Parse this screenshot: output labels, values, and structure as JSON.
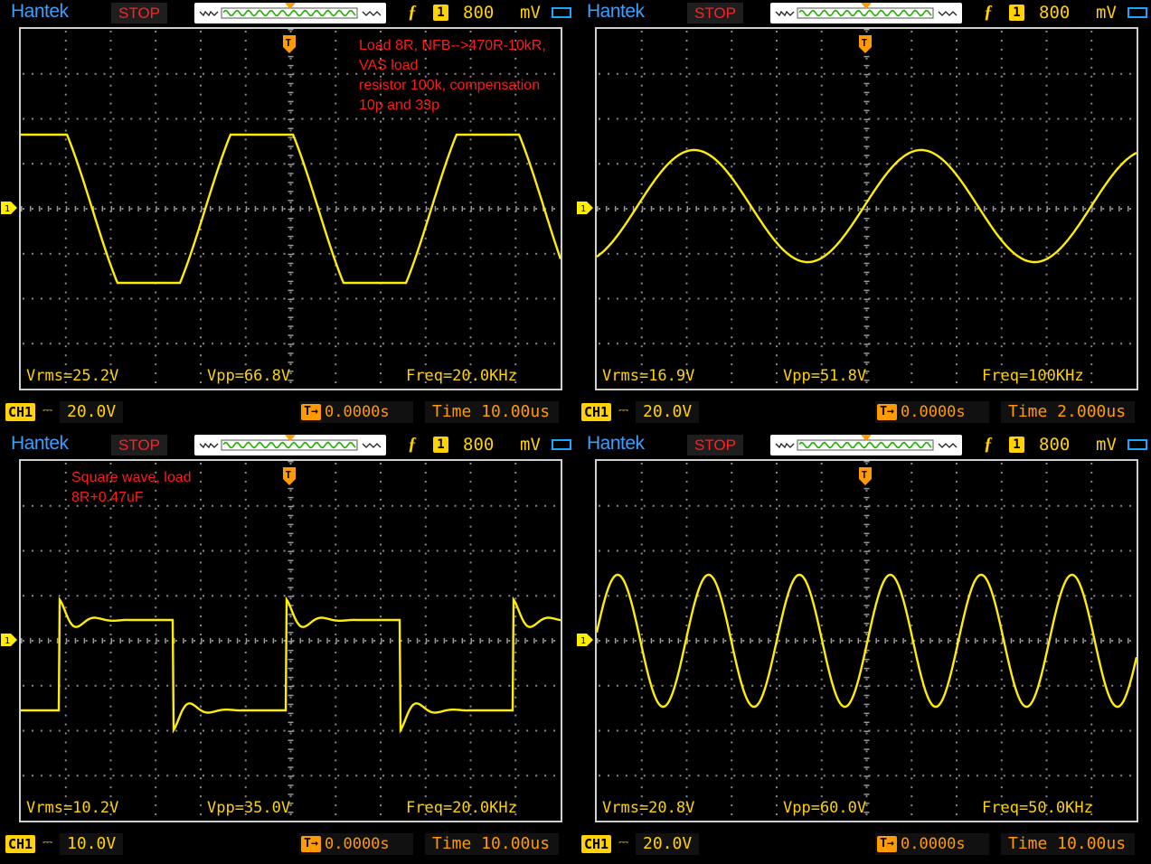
{
  "panels": [
    {
      "brand": "Hantek",
      "status": "STOP",
      "trig_level": "800",
      "trig_unit": "mV",
      "ch_badge": "1",
      "note": [
        "Load 8R, NFB-->470R-10kR, VAS load",
        "resistor 100k, compensation 10p and 33p"
      ],
      "vrms": "Vrms=25.2V",
      "vpp": "Vpp=66.8V",
      "freq": "Freq=20.0KHz",
      "ch": "CH1",
      "coupling": "DC",
      "vdiv": "20.0V",
      "tpos": "0.0000s",
      "tbase": "Time 10.00us",
      "waveform": "clipped-sine"
    },
    {
      "brand": "Hantek",
      "status": "STOP",
      "trig_level": "800",
      "trig_unit": "mV",
      "ch_badge": "1",
      "note": [],
      "vrms": "Vrms=16.9V",
      "vpp": "Vpp=51.8V",
      "freq": "Freq=100KHz",
      "ch": "CH1",
      "coupling": "DC",
      "vdiv": "20.0V",
      "tpos": "0.0000s",
      "tbase": "Time 2.000us",
      "waveform": "sine-100k"
    },
    {
      "brand": "Hantek",
      "status": "STOP",
      "trig_level": "800",
      "trig_unit": "mV",
      "ch_badge": "1",
      "note": [
        "Square wave, load",
        "8R+0.47uF"
      ],
      "vrms": "Vrms=10.2V",
      "vpp": "Vpp=35.0V",
      "freq": "Freq=20.0KHz",
      "ch": "CH1",
      "coupling": "DC",
      "vdiv": "10.0V",
      "tpos": "0.0000s",
      "tbase": "Time 10.00us",
      "waveform": "square-ringing"
    },
    {
      "brand": "Hantek",
      "status": "STOP",
      "trig_level": "800",
      "trig_unit": "mV",
      "ch_badge": "1",
      "note": [],
      "vrms": "Vrms=20.8V",
      "vpp": "Vpp=60.0V",
      "freq": "Freq=50.0KHz",
      "ch": "CH1",
      "coupling": "DC",
      "vdiv": "20.0V",
      "tpos": "0.0000s",
      "tbase": "Time 10.00us",
      "waveform": "sine-50k"
    }
  ],
  "colors": {
    "trace": "#ffee00",
    "brand": "#39a0ff",
    "stop": "#ff2222",
    "timebase": "#ff9a00",
    "note": "#ff1a1a",
    "grid": "#8a8a8a"
  },
  "icons": {
    "trigger_marker": "T-trigger-icon",
    "level_marker": "ch1-level-icon",
    "coupling": "ac-coupling-icon",
    "edge": "rising-edge-icon"
  }
}
